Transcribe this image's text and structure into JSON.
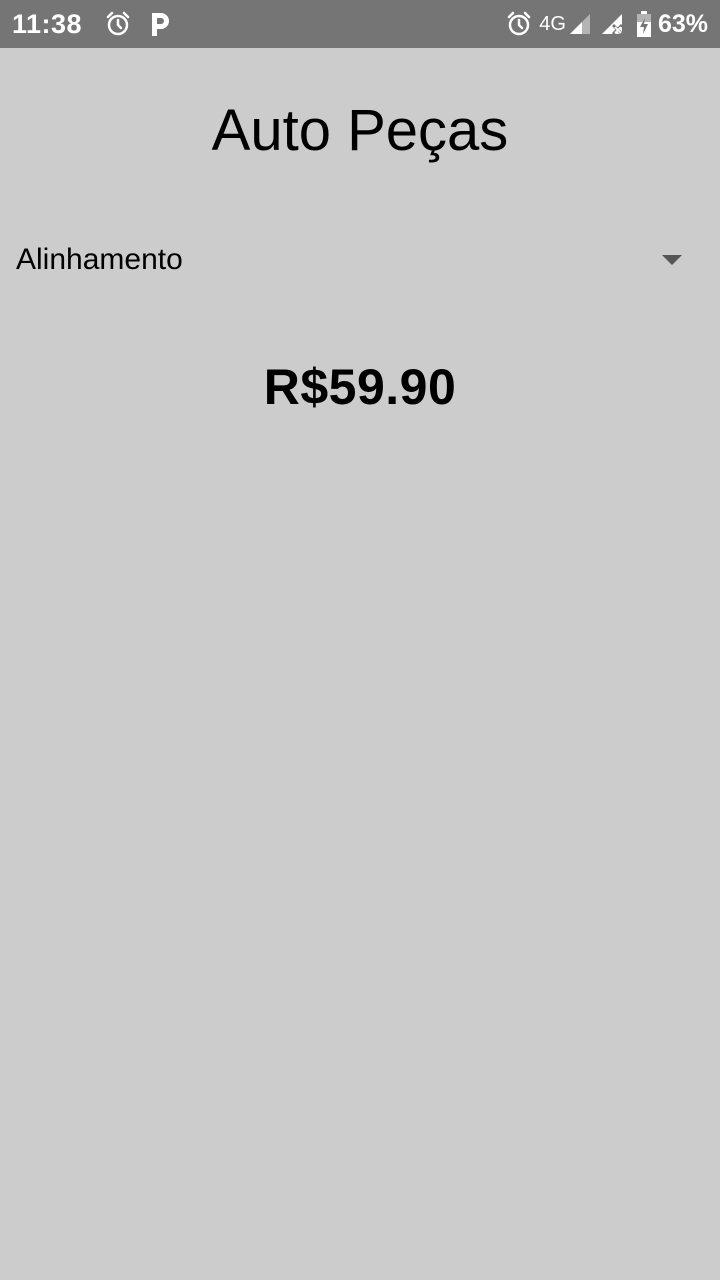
{
  "status_bar": {
    "time": "11:38",
    "network": "4G",
    "battery": "63%",
    "left_icons": [
      "alarm-icon",
      "parking-app-icon"
    ],
    "right_icons": [
      "alarm-icon",
      "signal-icon",
      "signal-no-sim-icon",
      "battery-charging-icon"
    ],
    "background": "#757575"
  },
  "app": {
    "title": "Auto Peças",
    "background": "#cccccc"
  },
  "service_select": {
    "selected": "Alinhamento",
    "icon": "dropdown-arrow-icon"
  },
  "price": {
    "value": "R$59.90"
  }
}
